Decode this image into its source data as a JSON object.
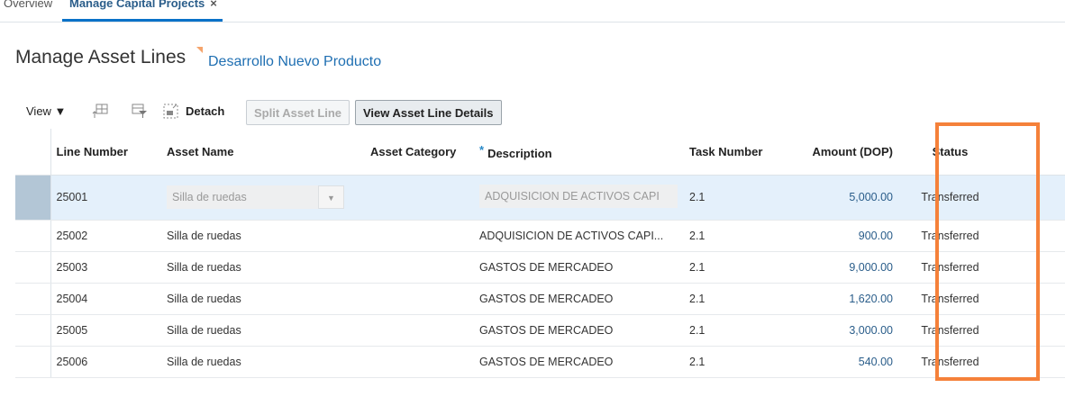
{
  "tabs": [
    {
      "label": "Overview"
    },
    {
      "label": "Manage Capital Projects",
      "close": "×"
    }
  ],
  "header": {
    "title": "Manage Asset Lines",
    "subtitle": "Desarrollo Nuevo Producto"
  },
  "toolbar": {
    "view": "View ▼",
    "detach": "Detach",
    "split": "Split Asset Line",
    "details": "View Asset Line Details"
  },
  "columns": [
    "Line Number",
    "Asset Name",
    "Asset Category",
    "Description",
    "Task Number",
    "Amount (DOP)",
    "Status"
  ],
  "required_mark": "*",
  "rows": [
    {
      "line": "25001",
      "asset": "Silla de ruedas",
      "category": "",
      "desc": "ADQUISICION DE ACTIVOS CAPI",
      "task": "2.1",
      "amount": "5,000.00",
      "status": "Transferred"
    },
    {
      "line": "25002",
      "asset": "Silla de ruedas",
      "category": "",
      "desc": "ADQUISICION DE ACTIVOS CAPI...",
      "task": "2.1",
      "amount": "900.00",
      "status": "Transferred"
    },
    {
      "line": "25003",
      "asset": "Silla de ruedas",
      "category": "",
      "desc": "GASTOS DE MERCADEO",
      "task": "2.1",
      "amount": "9,000.00",
      "status": "Transferred"
    },
    {
      "line": "25004",
      "asset": "Silla de ruedas",
      "category": "",
      "desc": "GASTOS DE MERCADEO",
      "task": "2.1",
      "amount": "1,620.00",
      "status": "Transferred"
    },
    {
      "line": "25005",
      "asset": "Silla de ruedas",
      "category": "",
      "desc": "GASTOS DE MERCADEO",
      "task": "2.1",
      "amount": "3,000.00",
      "status": "Transferred"
    },
    {
      "line": "25006",
      "asset": "Silla de ruedas",
      "category": "",
      "desc": "GASTOS DE MERCADEO",
      "task": "2.1",
      "amount": "540.00",
      "status": "Transferred"
    }
  ]
}
